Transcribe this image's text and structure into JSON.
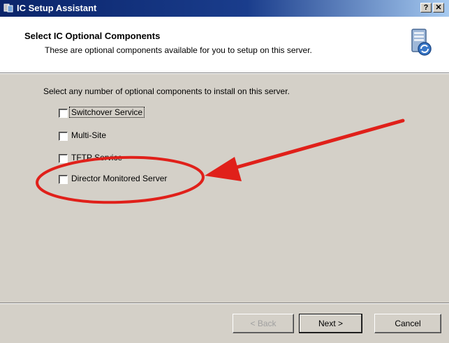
{
  "window": {
    "title": "IC Setup Assistant",
    "help_glyph": "?",
    "close_glyph": "✕"
  },
  "header": {
    "title": "Select IC Optional Components",
    "subtitle": "These are optional components available for you to setup on this server."
  },
  "main": {
    "instruction": "Select any number of optional components to install on this server.",
    "options": [
      {
        "label": "Switchover Service",
        "checked": false
      },
      {
        "label": "Multi-Site",
        "checked": false
      },
      {
        "label": "TFTP Service",
        "checked": false
      },
      {
        "label": "Director Monitored Server",
        "checked": false
      }
    ]
  },
  "buttons": {
    "back": "< Back",
    "next": "Next >",
    "cancel": "Cancel"
  },
  "annotation": {
    "color": "#e0201a",
    "icons": [
      "red-ellipse-icon",
      "red-arrow-icon"
    ]
  },
  "colors": {
    "titlebar": "#0a246a",
    "dialog_bg": "#d4d0c8"
  }
}
